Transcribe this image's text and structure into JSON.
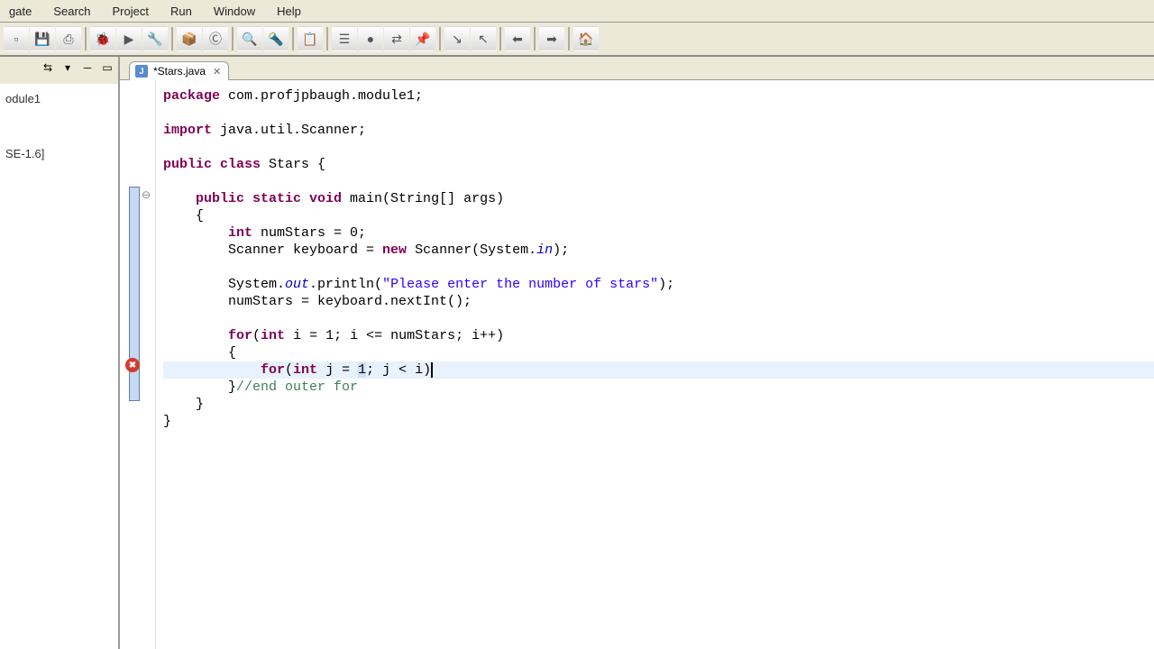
{
  "menu": {
    "items": [
      "gate",
      "Search",
      "Project",
      "Run",
      "Window",
      "Help"
    ]
  },
  "toolbar": {
    "icons": [
      "new",
      "save",
      "print",
      "sep",
      "debug",
      "run",
      "ext-tools",
      "sep",
      "new-pkg",
      "new-class",
      "sep",
      "open-type",
      "search",
      "sep",
      "task",
      "sep",
      "outline",
      "breakpoints",
      "sep",
      "next-ann",
      "prev-ann",
      "sep",
      "back",
      "sep",
      "forward",
      "sep",
      "home"
    ]
  },
  "sidebar": {
    "header_icons": [
      "link",
      "menu",
      "min",
      "max"
    ],
    "items": [
      "odule1",
      "SE-1.6]"
    ]
  },
  "tab": {
    "label": "*Stars.java"
  },
  "code": {
    "line01a": "package",
    "line01b": " com.profjpbaugh.module1;",
    "line03a": "import",
    "line03b": " java.util.Scanner;",
    "line05a": "public",
    "line05b": " class",
    "line05c": " Stars {",
    "line07a": "    public",
    "line07b": " static",
    "line07c": " void",
    "line07d": " main(String[] args)",
    "line08": "    {",
    "line09a": "        int",
    "line09b": " numStars = 0;",
    "line10a": "        Scanner keyboard = ",
    "line10b": "new",
    "line10c": " Scanner(System.",
    "line10d": "in",
    "line10e": ");",
    "line12a": "        System.",
    "line12b": "out",
    "line12c": ".println(",
    "line12d": "\"Please enter the number of stars\"",
    "line12e": ");",
    "line13": "        numStars = keyboard.nextInt();",
    "line15a": "        for",
    "line15b": "(",
    "line15c": "int",
    "line15d": " i = 1; i <= numStars; i++)",
    "line16": "        {",
    "line17a": "            for",
    "line17b": "(",
    "line17c": "int",
    "line17d": " j = ",
    "line17e": "1",
    "line17f": "; j < i)",
    "line18a": "        }",
    "line18b": "//end outer for",
    "line19": "    }",
    "line20": "}"
  }
}
